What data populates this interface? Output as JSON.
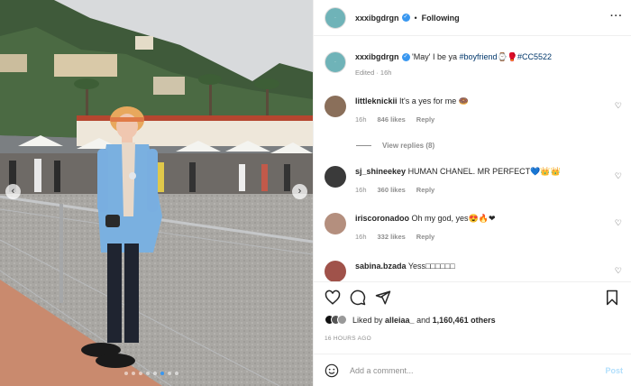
{
  "post": {
    "username": "xxxibgdrgn",
    "follow_status": "Following",
    "more_icon": "more-horizontal-icon",
    "avatar_text": "·",
    "caption_prefix": "'May' I be ya ",
    "caption_tag1": "#boyfriend",
    "caption_emojis": "⌚🥊",
    "caption_tag2": "#CC5522",
    "edited_label": "Edited · 16h",
    "carousel_total": 8,
    "carousel_active": 6
  },
  "comments": [
    {
      "username": "littleknickii",
      "text": "It's a yes for me 🍩",
      "time": "16h",
      "likes": "846 likes",
      "reply": "Reply",
      "avatar_color": "#8a6f5a"
    },
    {
      "username": "sj_shineekey",
      "text": "HUMAN CHANEL. MR PERFECT💙👑👑",
      "time": "16h",
      "likes": "360 likes",
      "reply": "Reply",
      "avatar_color": "#3a3a3a"
    },
    {
      "username": "iriscoronadoo",
      "text": "Oh my god, yes😍🔥❤",
      "time": "16h",
      "likes": "332 likes",
      "reply": "Reply",
      "avatar_color": "#b48f7e"
    },
    {
      "username": "sabina.bzada",
      "text": "Yess□□□□□□",
      "avatar_color": "#a0524a"
    }
  ],
  "view_replies": "View replies (8)",
  "likes": {
    "prefix": "Liked by ",
    "first_user": "alleiaa_",
    "connector": " and ",
    "count": "1,160,461 others"
  },
  "timestamp": "16 HOURS AGO",
  "add_comment": {
    "placeholder": "Add a comment...",
    "post_label": "Post"
  },
  "icons": {
    "like": "heart-icon",
    "comment": "comment-icon",
    "share": "share-icon",
    "save": "bookmark-icon",
    "emoji": "emoji-icon",
    "prev": "chevron-left-icon",
    "next": "chevron-right-icon"
  },
  "colors": {
    "accent": "#3897f0",
    "tag": "#00376b",
    "muted": "#8e8e8e",
    "post_button": "#b2dffc"
  },
  "nav": {
    "prev": "‹",
    "next": "›"
  }
}
